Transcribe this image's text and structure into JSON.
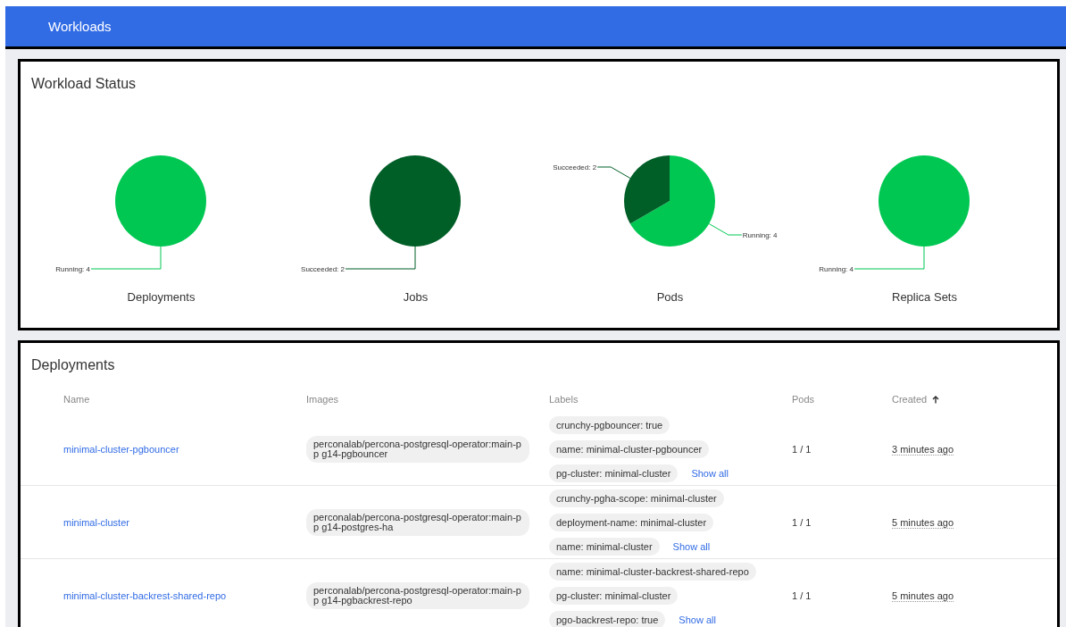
{
  "header": {
    "title": "Workloads"
  },
  "workload_status": {
    "title": "Workload Status",
    "charts": [
      {
        "chart_data": {
          "type": "pie",
          "title": "Deployments",
          "categories": [
            "Running: 4"
          ],
          "values": [
            4
          ],
          "colors": [
            "#00c752"
          ]
        }
      },
      {
        "chart_data": {
          "type": "pie",
          "title": "Jobs",
          "categories": [
            "Succeeded: 2"
          ],
          "values": [
            2
          ],
          "colors": [
            "#005e27"
          ]
        }
      },
      {
        "chart_data": {
          "type": "pie",
          "title": "Pods",
          "categories": [
            "Running: 4",
            "Succeeded: 2"
          ],
          "values": [
            4,
            2
          ],
          "colors": [
            "#00c752",
            "#005e27"
          ]
        }
      },
      {
        "chart_data": {
          "type": "pie",
          "title": "Replica Sets",
          "categories": [
            "Running: 4"
          ],
          "values": [
            4
          ],
          "colors": [
            "#00c752"
          ]
        }
      }
    ]
  },
  "deployments": {
    "title": "Deployments",
    "columns": [
      {
        "label": "Name",
        "sorted": false
      },
      {
        "label": "Images",
        "sorted": false
      },
      {
        "label": "Labels",
        "sorted": false
      },
      {
        "label": "Pods",
        "sorted": false
      },
      {
        "label": "Created",
        "sorted": true
      }
    ],
    "rows": [
      {
        "name": "minimal-cluster-pgbouncer",
        "image": "perconalab/percona-postgresql-operator:main-pp g14-pgbouncer",
        "labels": [
          "crunchy-pgbouncer: true",
          "name: minimal-cluster-pgbouncer",
          "pg-cluster: minimal-cluster"
        ],
        "show_all": "Show all",
        "pods": "1 / 1",
        "created": "3 minutes ago"
      },
      {
        "name": "minimal-cluster",
        "image": "perconalab/percona-postgresql-operator:main-pp g14-postgres-ha",
        "labels": [
          "crunchy-pgha-scope: minimal-cluster",
          "deployment-name: minimal-cluster",
          "name: minimal-cluster"
        ],
        "show_all": "Show all",
        "pods": "1 / 1",
        "created": "5 minutes ago"
      },
      {
        "name": "minimal-cluster-backrest-shared-repo",
        "image": "perconalab/percona-postgresql-operator:main-pp g14-pgbackrest-repo",
        "labels": [
          "name: minimal-cluster-backrest-shared-repo",
          "pg-cluster: minimal-cluster",
          "pgo-backrest-repo: true"
        ],
        "show_all": "Show all",
        "pods": "1 / 1",
        "created": "5 minutes ago"
      }
    ]
  }
}
